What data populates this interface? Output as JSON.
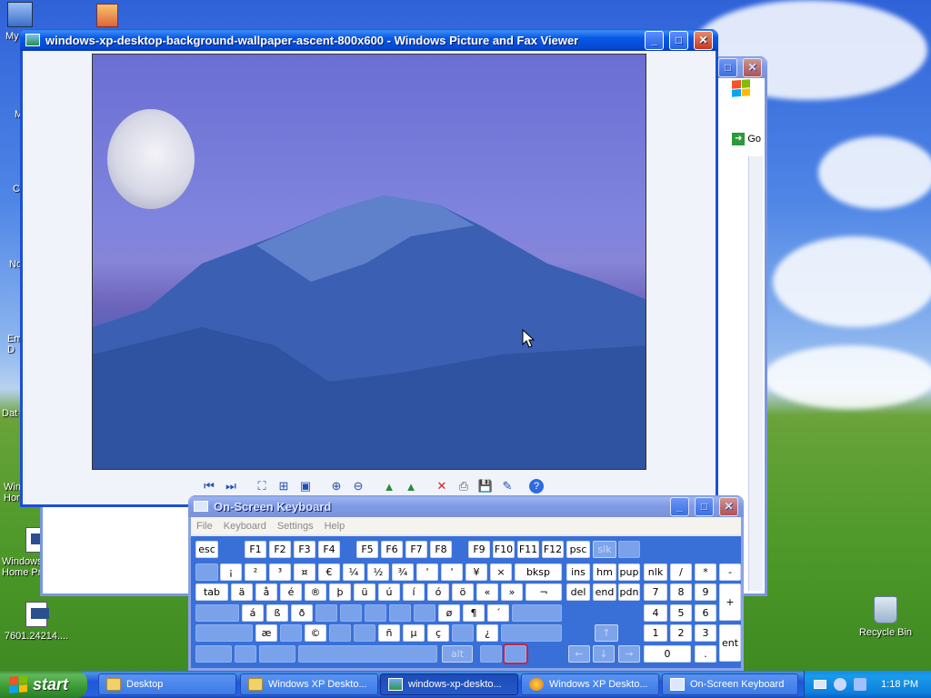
{
  "desktop": {
    "icons": [
      {
        "label": "My",
        "name": "my-documents"
      },
      {
        "label": "Windows Home Pr",
        "name": "windows-home-pr"
      },
      {
        "label": "7601.24214....",
        "name": "file-7601"
      },
      {
        "label": "Recycle Bin",
        "name": "recycle-bin"
      }
    ],
    "edge_labels": [
      "M",
      "C",
      "No",
      "Em D",
      "Dat",
      "Win Hon"
    ]
  },
  "viewer": {
    "title": "windows-xp-desktop-background-wallpaper-ascent-800x600 - Windows Picture and Fax Viewer",
    "toolbar": [
      "previous-image",
      "next-image",
      "best-fit",
      "actual-size",
      "slideshow",
      "zoom-in",
      "zoom-out",
      "rotate-clockwise",
      "rotate-counterclockwise",
      "delete",
      "print",
      "copy-to",
      "open-for-editing",
      "help"
    ]
  },
  "explorer": {
    "go_label": "Go"
  },
  "osk": {
    "title": "On-Screen Keyboard",
    "menu": [
      "File",
      "Keyboard",
      "Settings",
      "Help"
    ],
    "row1": [
      "esc",
      "F1",
      "F2",
      "F3",
      "F4",
      "F5",
      "F6",
      "F7",
      "F8",
      "F9",
      "F10",
      "F11",
      "F12",
      "psc",
      "slk",
      ""
    ],
    "row2": [
      "",
      "¡",
      "²",
      "³",
      "¤",
      "€",
      "¼",
      "½",
      "¾",
      "'",
      "'",
      "¥",
      "×",
      "bksp",
      "ins",
      "hm",
      "pup",
      "nlk",
      "/",
      "*",
      "-"
    ],
    "row3": [
      "tab",
      "ä",
      "å",
      "é",
      "®",
      "þ",
      "ü",
      "ú",
      "í",
      "ó",
      "ö",
      "«",
      "»",
      "¬",
      "del",
      "end",
      "pdn",
      "7",
      "8",
      "9",
      "+"
    ],
    "row4": [
      "",
      "á",
      "ß",
      "ð",
      "",
      "",
      "",
      "",
      "",
      "ø",
      "¶",
      "´",
      "",
      "4",
      "5",
      "6"
    ],
    "row5": [
      "",
      "æ",
      "",
      "©",
      "",
      "",
      "ñ",
      "µ",
      "ç",
      "",
      "¿",
      "",
      "↑",
      "1",
      "2",
      "3",
      "ent"
    ],
    "row6": [
      "",
      "",
      "",
      "",
      "alt",
      "",
      "",
      "←",
      "↓",
      "→",
      "0",
      "."
    ]
  },
  "taskbar": {
    "start": "start",
    "tasks": [
      {
        "label": "Desktop",
        "icon": "folder"
      },
      {
        "label": "Windows XP Deskto...",
        "icon": "folder"
      },
      {
        "label": "windows-xp-deskto...",
        "icon": "image",
        "active": true
      },
      {
        "label": "Windows XP Deskto...",
        "icon": "browser"
      },
      {
        "label": "On-Screen Keyboard",
        "icon": "keyboard"
      }
    ],
    "clock": "1:18 PM"
  }
}
